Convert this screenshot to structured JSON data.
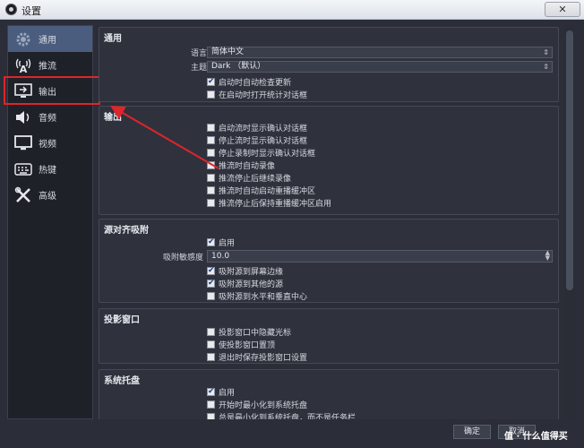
{
  "window": {
    "title": "设置",
    "close_label": "✕"
  },
  "sidebar": {
    "items": [
      {
        "label": "通用",
        "icon": "gear-icon"
      },
      {
        "label": "推流",
        "icon": "antenna-icon"
      },
      {
        "label": "输出",
        "icon": "output-icon"
      },
      {
        "label": "音频",
        "icon": "speaker-icon"
      },
      {
        "label": "视频",
        "icon": "monitor-icon"
      },
      {
        "label": "热键",
        "icon": "keyboard-icon"
      },
      {
        "label": "高级",
        "icon": "tools-icon"
      }
    ],
    "active_index": 0,
    "highlight_color": "#e0242a"
  },
  "general": {
    "title": "通用",
    "language_label": "语言",
    "language_value": "简体中文",
    "theme_label": "主题",
    "theme_value": "Dark （默认）",
    "check_updates": "启动时自动检查更新",
    "open_stats": "在启动时打开统计对话框"
  },
  "output": {
    "title": "输出",
    "options": [
      {
        "label": "启动流时显示确认对话框",
        "checked": false
      },
      {
        "label": "停止流时显示确认对话框",
        "checked": false
      },
      {
        "label": "停止录制时显示确认对话框",
        "checked": false
      },
      {
        "label": "推流时自动录像",
        "checked": false
      },
      {
        "label": "推流停止后继续录像",
        "checked": false
      },
      {
        "label": "推流时自动启动重播缓冲区",
        "checked": false
      },
      {
        "label": "推流停止后保持重播缓冲区启用",
        "checked": false
      }
    ]
  },
  "snapping": {
    "title": "源对齐吸附",
    "enable": "启用",
    "sensitivity_label": "吸附敏感度",
    "sensitivity_value": "10.0",
    "options": [
      {
        "label": "吸附源到屏幕边缘",
        "checked": true
      },
      {
        "label": "吸附源到其他的源",
        "checked": true
      },
      {
        "label": "吸附源到水平和垂直中心",
        "checked": false
      }
    ]
  },
  "projector": {
    "title": "投影窗口",
    "options": [
      {
        "label": "投影窗口中隐藏光标",
        "checked": false
      },
      {
        "label": "使投影窗口置顶",
        "checked": false
      },
      {
        "label": "退出时保存投影窗口设置",
        "checked": false
      }
    ]
  },
  "tray": {
    "title": "系统托盘",
    "options": [
      {
        "label": "启用",
        "checked": true
      },
      {
        "label": "开始时最小化到系统托盘",
        "checked": false
      },
      {
        "label": "总是最小化到系统托盘，而不是任务栏",
        "checked": false
      }
    ]
  },
  "footer": {
    "ok": "确定",
    "cancel": "取消"
  },
  "watermark": "值 · 什么值得买"
}
